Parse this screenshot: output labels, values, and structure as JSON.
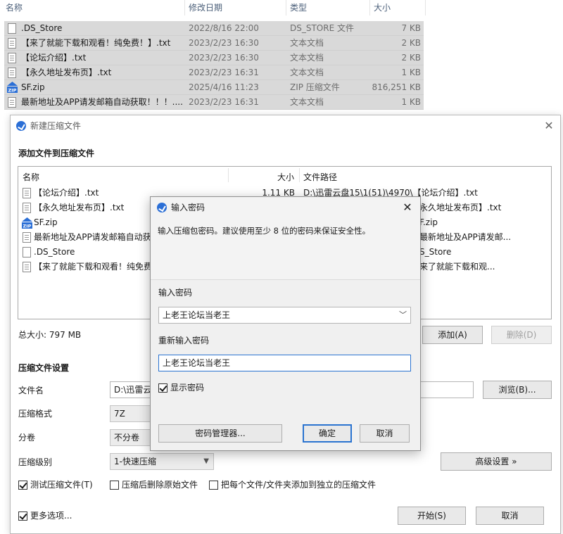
{
  "explorer": {
    "headers": {
      "name": "名称",
      "date": "修改日期",
      "type": "类型",
      "size": "大小"
    },
    "rows": [
      {
        "name": ".DS_Store",
        "date": "2022/8/16 22:00",
        "type": "DS_STORE 文件",
        "size": "7 KB",
        "icon": "file-icon"
      },
      {
        "name": "【来了就能下载和观看！纯免费！】.txt",
        "date": "2023/2/23 16:30",
        "type": "文本文档",
        "size": "2 KB",
        "icon": "text-file-icon"
      },
      {
        "name": "【论坛介绍】.txt",
        "date": "2023/2/23 16:30",
        "type": "文本文档",
        "size": "2 KB",
        "icon": "text-file-icon"
      },
      {
        "name": "【永久地址发布页】.txt",
        "date": "2023/2/23 16:31",
        "type": "文本文档",
        "size": "1 KB",
        "icon": "text-file-icon"
      },
      {
        "name": "SF.zip",
        "date": "2025/4/16 11:23",
        "type": "ZIP 压缩文件",
        "size": "816,251 KB",
        "icon": "zip-icon"
      },
      {
        "name": "最新地址及APP请发邮箱自动获取！！！....",
        "date": "2023/2/23 16:31",
        "type": "文本文档",
        "size": "1 KB",
        "icon": "text-file-icon"
      }
    ]
  },
  "compress_window": {
    "title": "新建压缩文件",
    "section_add": "添加文件到压缩文件",
    "list_headers": {
      "name": "名称",
      "size": "大小",
      "path": "文件路径"
    },
    "files": [
      {
        "name": "【论坛介绍】.txt",
        "size": "1.11 KB",
        "path": "D:\\迅雷云盘15\\1(51)\\4970\\【论坛介绍】.txt",
        "icon": "text-file-icon"
      },
      {
        "name": "【永久地址发布页】.txt",
        "size": "",
        "path": "永久地址发布页】.txt",
        "icon": "text-file-icon"
      },
      {
        "name": "SF.zip",
        "size": "",
        "path": "F.zip",
        "icon": "zip-icon"
      },
      {
        "name": "最新地址及APP请发邮箱自动获",
        "size": "",
        "path": "最新地址及APP请发邮...",
        "icon": "text-file-icon"
      },
      {
        "name": ".DS_Store",
        "size": "",
        "path": "S_Store",
        "icon": "file-icon"
      },
      {
        "name": "【来了就能下载和观看！纯免费",
        "size": "",
        "path": "来了就能下载和观...",
        "icon": "text-file-icon"
      }
    ],
    "total_size": "总大小: 797 MB",
    "add_button": "添加(A)",
    "delete_button": "删除(D)",
    "section_settings": "压缩文件设置",
    "filename_label": "文件名",
    "filename_value": "D:\\迅雷云",
    "browse_button": "浏览(B)...",
    "format_label": "压缩格式",
    "format_value": "7Z",
    "split_label": "分卷",
    "split_value": "不分卷",
    "level_label": "压缩级别",
    "level_value": "1-快速压缩",
    "advanced_button": "高级设置 »",
    "test_checkbox": "测试压缩文件(T)",
    "delete_after_checkbox": "压缩后删除原始文件",
    "each_file_checkbox": "把每个文件/文件夹添加到独立的压缩文件",
    "more_options_checkbox": "更多选项...",
    "start_button": "开始(S)",
    "cancel_button": "取消"
  },
  "password_dialog": {
    "title": "输入密码",
    "hint": "输入压缩包密码。建议使用至少 8 位的密码来保证安全性。",
    "enter_label": "输入密码",
    "enter_value": "上老王论坛当老王",
    "reenter_label": "重新输入密码",
    "reenter_value": "上老王论坛当老王",
    "show_password": "显示密码",
    "manager_button": "密码管理器...",
    "ok_button": "确定",
    "cancel_button": "取消"
  }
}
